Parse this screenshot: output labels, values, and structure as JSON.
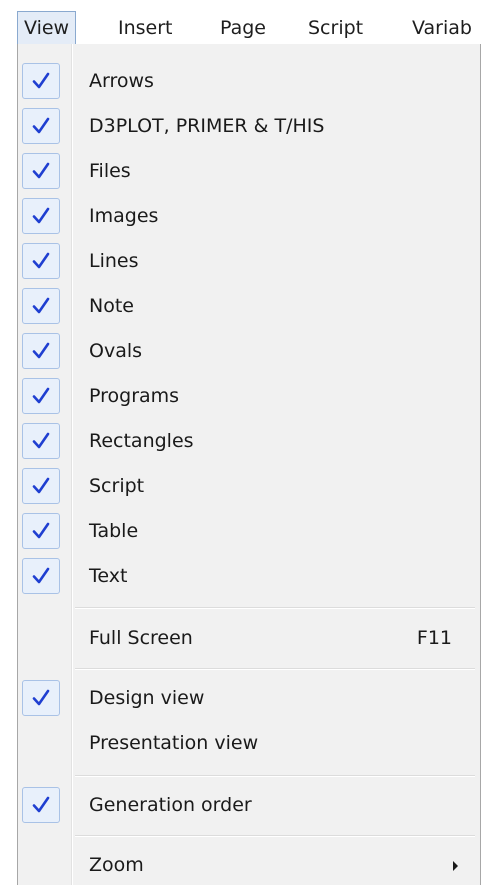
{
  "menubar": {
    "items": [
      {
        "label": "View",
        "active": true
      },
      {
        "label": "Insert"
      },
      {
        "label": "Page"
      },
      {
        "label": "Script"
      },
      {
        "label": "Variab"
      }
    ]
  },
  "view_menu": {
    "items": [
      {
        "label": "Arrows",
        "checked": true
      },
      {
        "label": "D3PLOT, PRIMER & T/HIS",
        "checked": true
      },
      {
        "label": "Files",
        "checked": true
      },
      {
        "label": "Images",
        "checked": true
      },
      {
        "label": "Lines",
        "checked": true
      },
      {
        "label": "Note",
        "checked": true
      },
      {
        "label": "Ovals",
        "checked": true
      },
      {
        "label": "Programs",
        "checked": true
      },
      {
        "label": "Rectangles",
        "checked": true
      },
      {
        "label": "Script",
        "checked": true
      },
      {
        "label": "Table",
        "checked": true
      },
      {
        "label": "Text",
        "checked": true
      },
      {
        "label": "Full Screen",
        "checked": false,
        "shortcut": "F11"
      },
      {
        "label": "Design view",
        "checked": true
      },
      {
        "label": "Presentation view",
        "checked": false
      },
      {
        "label": "Generation order",
        "checked": true
      },
      {
        "label": "Zoom",
        "checked": false,
        "submenu": true
      }
    ]
  },
  "colors": {
    "check": "#1f3fd1",
    "menu_bg": "#f1f1f1",
    "active_tab_bg": "#e4ecf7"
  }
}
